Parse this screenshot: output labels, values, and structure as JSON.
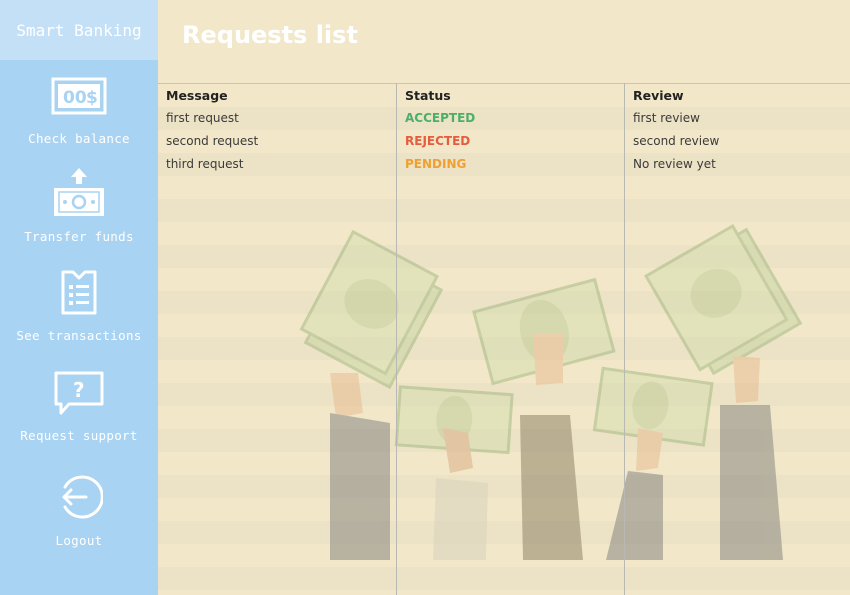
{
  "app": {
    "brand": "Smart Banking"
  },
  "sidebar": {
    "items": [
      {
        "label": "Check balance",
        "icon": "balance-icon"
      },
      {
        "label": "Transfer funds",
        "icon": "transfer-icon"
      },
      {
        "label": "See transactions",
        "icon": "transactions-icon"
      },
      {
        "label": "Request support",
        "icon": "support-icon"
      },
      {
        "label": "Logout",
        "icon": "logout-icon"
      }
    ]
  },
  "main": {
    "title": "Requests list",
    "table": {
      "columns": [
        "Message",
        "Status",
        "Review"
      ],
      "rows": [
        {
          "message": "first request",
          "status": "ACCEPTED",
          "review": "first review"
        },
        {
          "message": "second request",
          "status": "REJECTED",
          "review": "second review"
        },
        {
          "message": "third request",
          "status": "PENDING",
          "review": "No review yet"
        }
      ]
    }
  },
  "colors": {
    "sidebar_bg": "#a9d3f2",
    "brand_bg": "#c4e0f6",
    "content_bg": "#f2e8c9",
    "status_accepted": "#4caf68",
    "status_rejected": "#e35d3f",
    "status_pending": "#f0a030"
  },
  "icons": {
    "balance": "balance-icon",
    "transfer": "transfer-icon",
    "transactions": "transactions-icon",
    "support": "support-icon",
    "logout": "logout-icon"
  }
}
